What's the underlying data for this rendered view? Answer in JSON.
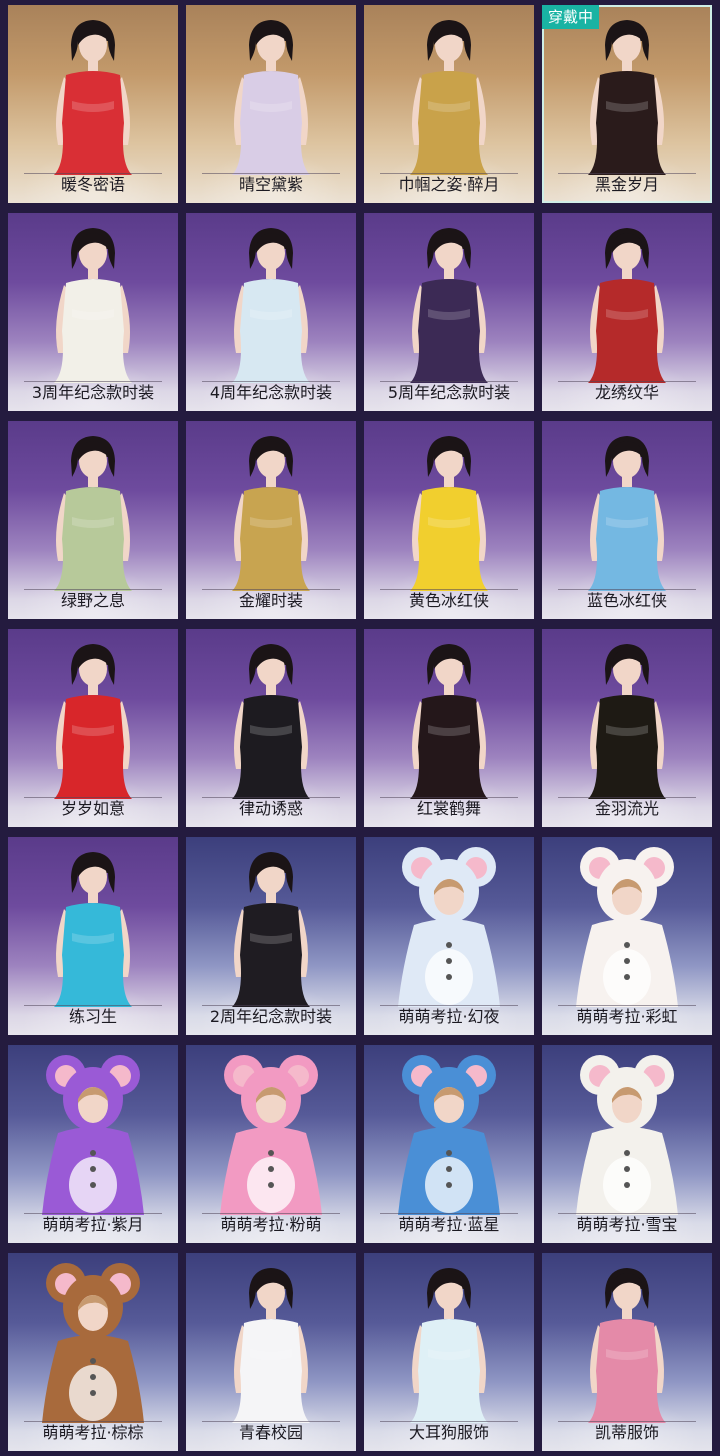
{
  "badge_label": "穿戴中",
  "colors": {
    "page_background": "#241b3f",
    "badge": "#19b3a3"
  },
  "outfits": [
    {
      "name": "暖冬密语",
      "theme": "warm",
      "outfit_color": "#d92f35",
      "hair": "#1b1416",
      "type": "human"
    },
    {
      "name": "晴空黛紫",
      "theme": "warm",
      "outfit_color": "#d9cde6",
      "hair": "#1b1416",
      "type": "human"
    },
    {
      "name": "巾帼之姿·醉月",
      "theme": "warm",
      "outfit_color": "#c9a24a",
      "hair": "#1b1416",
      "type": "human"
    },
    {
      "name": "黑金岁月",
      "theme": "warm",
      "outfit_color": "#2a1b1b",
      "hair": "#1b1416",
      "type": "human",
      "equipped": true
    },
    {
      "name": "3周年纪念款时装",
      "theme": "purple",
      "outfit_color": "#f2f0e8",
      "hair": "#1b1416",
      "type": "human"
    },
    {
      "name": "4周年纪念款时装",
      "theme": "purple",
      "outfit_color": "#d7e8f2",
      "hair": "#1b1416",
      "type": "human"
    },
    {
      "name": "5周年纪念款时装",
      "theme": "purple",
      "outfit_color": "#3c2a55",
      "hair": "#1b1416",
      "type": "human"
    },
    {
      "name": "龙绣纹华",
      "theme": "purple",
      "outfit_color": "#b52a2a",
      "hair": "#1b1416",
      "type": "human"
    },
    {
      "name": "绿野之息",
      "theme": "purple",
      "outfit_color": "#b7c99a",
      "hair": "#1b1416",
      "type": "human"
    },
    {
      "name": "金耀时装",
      "theme": "purple",
      "outfit_color": "#c8a450",
      "hair": "#1b1416",
      "type": "human"
    },
    {
      "name": "黄色冰红侠",
      "theme": "purple",
      "outfit_color": "#f1cf2e",
      "hair": "#1b1416",
      "type": "human"
    },
    {
      "name": "蓝色冰红侠",
      "theme": "purple",
      "outfit_color": "#74b8e2",
      "hair": "#1b1416",
      "type": "human"
    },
    {
      "name": "岁岁如意",
      "theme": "purple",
      "outfit_color": "#d8262a",
      "hair": "#1b1416",
      "type": "human"
    },
    {
      "name": "律动诱惑",
      "theme": "purple",
      "outfit_color": "#1d1b20",
      "hair": "#1b1416",
      "type": "human"
    },
    {
      "name": "红裳鹤舞",
      "theme": "purple",
      "outfit_color": "#24171a",
      "hair": "#1b1416",
      "type": "human"
    },
    {
      "name": "金羽流光",
      "theme": "purple",
      "outfit_color": "#1e1a14",
      "hair": "#1b1416",
      "type": "human"
    },
    {
      "name": "练习生",
      "theme": "purple",
      "outfit_color": "#35b9d9",
      "hair": "#1b1416",
      "type": "human"
    },
    {
      "name": "2周年纪念款时装",
      "theme": "blue",
      "outfit_color": "#1f1c22",
      "hair": "#1b1416",
      "type": "human"
    },
    {
      "name": "萌萌考拉·幻夜",
      "theme": "blue",
      "outfit_color": "#dfe9f6",
      "hair": "#b8d6f0",
      "type": "koala"
    },
    {
      "name": "萌萌考拉·彩虹",
      "theme": "blue",
      "outfit_color": "#f7f2ef",
      "hair": "#f4b8cc",
      "type": "koala"
    },
    {
      "name": "萌萌考拉·紫月",
      "theme": "blue",
      "outfit_color": "#9a5ad6",
      "hair": "#9a5ad6",
      "type": "koala"
    },
    {
      "name": "萌萌考拉·粉萌",
      "theme": "blue",
      "outfit_color": "#f29ac2",
      "hair": "#f29ac2",
      "type": "koala"
    },
    {
      "name": "萌萌考拉·蓝星",
      "theme": "blue",
      "outfit_color": "#4a8fd6",
      "hair": "#4a8fd6",
      "type": "koala"
    },
    {
      "name": "萌萌考拉·雪宝",
      "theme": "blue",
      "outfit_color": "#f3f1ec",
      "hair": "#f3f1ec",
      "type": "koala"
    },
    {
      "name": "萌萌考拉·棕棕",
      "theme": "blue",
      "outfit_color": "#a86a3c",
      "hair": "#a86a3c",
      "type": "koala"
    },
    {
      "name": "青春校园",
      "theme": "blue",
      "outfit_color": "#f5f5f7",
      "hair": "#1b1416",
      "type": "human"
    },
    {
      "name": "大耳狗服饰",
      "theme": "blue",
      "outfit_color": "#dff0f6",
      "hair": "#1b1416",
      "type": "human"
    },
    {
      "name": "凯蒂服饰",
      "theme": "blue",
      "outfit_color": "#e48aa8",
      "hair": "#1b1416",
      "type": "human"
    }
  ]
}
